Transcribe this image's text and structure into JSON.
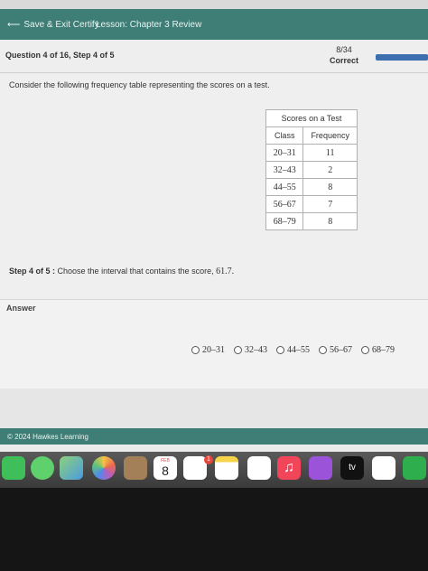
{
  "header": {
    "back_label": "Save & Exit Certify",
    "lesson_label": "Lesson: Chapter 3 Review"
  },
  "subbar": {
    "question_info": "Question 4 of 16, Step 4 of 5",
    "score": "8/34",
    "score_status": "Correct"
  },
  "problem": {
    "prompt": "Consider the following frequency table representing the scores on a test.",
    "table": {
      "caption": "Scores on a Test",
      "headers": [
        "Class",
        "Frequency"
      ],
      "rows": [
        [
          "20–31",
          "11"
        ],
        [
          "32–43",
          "2"
        ],
        [
          "44–55",
          "8"
        ],
        [
          "56–67",
          "7"
        ],
        [
          "68–79",
          "8"
        ]
      ]
    },
    "step_label": "Step 4 of 5 :",
    "step_text": "Choose the interval that contains the score,",
    "step_value": "61.7."
  },
  "answer": {
    "label": "Answer",
    "options": [
      "20–31",
      "32–43",
      "44–55",
      "56–67",
      "68–79"
    ]
  },
  "footer": {
    "copyright": "© 2024 Hawkes Learning"
  },
  "dock": {
    "calendar_month": "FEB",
    "calendar_day": "8",
    "reminders_badge": "1",
    "tv_label": "tv"
  },
  "colors": {
    "header_teal": "#3e7e76",
    "progress_blue": "#3d6fb0"
  }
}
